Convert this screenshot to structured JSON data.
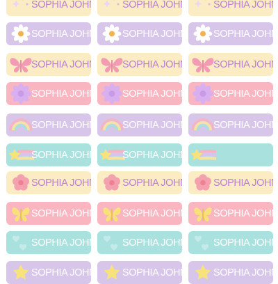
{
  "sheet": {
    "name_text": "SOPHIA JOHN",
    "rows": [
      {
        "motif": "sparkles-icon",
        "bg": "#fbecc4",
        "text_color": "#b97ed6",
        "names": [
          "SOPHIA JOHN",
          "SOPHIA JOHN",
          "SOPHIA JOHN"
        ]
      },
      {
        "motif": "daisy-icon",
        "bg": "#d8c6ea",
        "text_color": "#ffffff",
        "names": [
          "SOPHIA JOHN",
          "SOPHIA JOHN",
          "SOPHIA JOHN"
        ]
      },
      {
        "motif": "butterfly-icon",
        "bg": "#fbecc4",
        "text_color": "#b97ed6",
        "names": [
          "SOPHIA JOHN",
          "SOPHIA JOHN",
          "SOPHIA JOHN"
        ]
      },
      {
        "motif": "purple-flower-icon",
        "bg": "#f9b6c0",
        "text_color": "#ffffff",
        "names": [
          "SOPHIA JOHN",
          "SOPHIA JOHN",
          "SOPHIA JOHN"
        ]
      },
      {
        "motif": "rainbow-icon",
        "bg": "#d8c6ea",
        "text_color": "#ffffff",
        "names": [
          "SOPHIA JOHN",
          "SOPHIA JOHN",
          "SOPHIA JOHN"
        ]
      },
      {
        "motif": "shooting-star-icon",
        "bg": "#a9e1df",
        "text_color": "#ffffff",
        "names": [
          "SOPHIA JOHN",
          "SOPHIA JOHN",
          ""
        ]
      },
      {
        "motif": "pink-flower-icon",
        "bg": "#fbecc4",
        "text_color": "#b97ed6",
        "names": [
          "SOPHIA JOHN",
          "SOPHIA JOHN",
          "SOPHIA JOHN"
        ]
      },
      {
        "motif": "yellow-butterfly-icon",
        "bg": "#f9b6c0",
        "text_color": "#ffffff",
        "names": [
          "SOPHIA JOHN",
          "SOPHIA JOHN",
          "SOPHIA JOHN"
        ]
      },
      {
        "motif": "faint-hearts-icon",
        "bg": "#a9e1df",
        "text_color": "#ffffff",
        "names": [
          "SOPHIA JOHN",
          "SOPHIA JOHN",
          "SOPHIA JOHN"
        ]
      },
      {
        "motif": "star-icon",
        "bg": "#d8c6ea",
        "text_color": "#ffffff",
        "names": [
          "SOPHIA JOHN",
          "SOPHIA JOHN",
          "SOPHIA JOHN"
        ]
      }
    ]
  }
}
